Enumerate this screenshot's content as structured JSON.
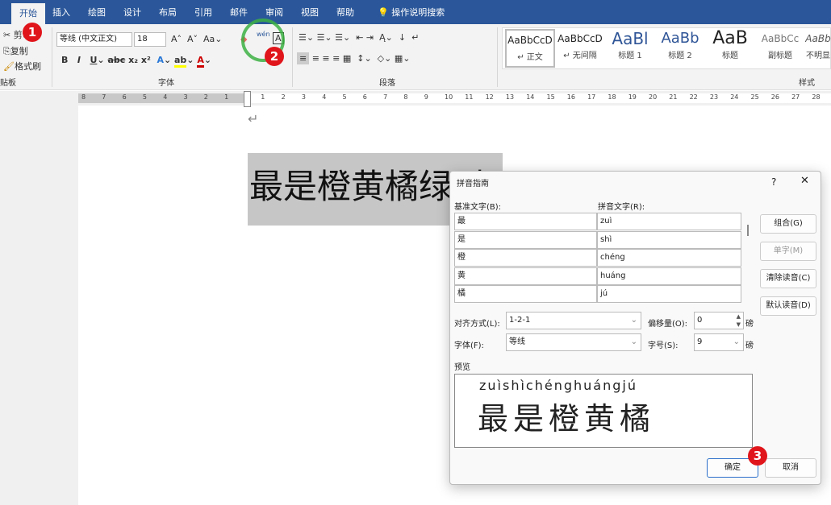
{
  "tabs": [
    "开始",
    "插入",
    "绘图",
    "设计",
    "布局",
    "引用",
    "邮件",
    "审阅",
    "视图",
    "帮助"
  ],
  "search": "操作说明搜索",
  "clipboard": {
    "cut": "剪切",
    "copy": "复制",
    "painter": "格式刷",
    "group": "贴板"
  },
  "font": {
    "name": "等线 (中文正文)",
    "size": "18",
    "group": "字体",
    "phonetic_icon": "wén"
  },
  "paragraph": {
    "group": "段落"
  },
  "styles": {
    "group": "样式",
    "items": [
      {
        "sample": "AaBbCcD",
        "name": "↵ 正文"
      },
      {
        "sample": "AaBbCcD",
        "name": "↵ 无间隔"
      },
      {
        "sample": "AaBl",
        "name": "标题 1"
      },
      {
        "sample": "AaBb",
        "name": "标题 2"
      },
      {
        "sample": "AaB",
        "name": "标题"
      },
      {
        "sample": "AaBbCc",
        "name": "副标题"
      },
      {
        "sample": "AaBb",
        "name": "不明显"
      }
    ]
  },
  "ruler": [
    "8",
    "7",
    "6",
    "5",
    "4",
    "3",
    "2",
    "1",
    "1",
    "2",
    "3",
    "4",
    "5",
    "6",
    "7",
    "8",
    "9",
    "10",
    "11",
    "12",
    "13",
    "14",
    "15",
    "16",
    "17",
    "18",
    "19",
    "20",
    "21",
    "22",
    "23",
    "24",
    "25",
    "26",
    "27",
    "28"
  ],
  "document": {
    "text": "最是橙黄橘绿时",
    "return_mark": "↵"
  },
  "dialog": {
    "title": "拼音指南",
    "help": "?",
    "close": "✕",
    "base_label": "基准文字(B):",
    "ruby_label": "拼音文字(R):",
    "rows": [
      {
        "base": "最",
        "ruby": "zuì"
      },
      {
        "base": "是",
        "ruby": "shì"
      },
      {
        "base": "橙",
        "ruby": "chéng"
      },
      {
        "base": "黄",
        "ruby": "huáng"
      },
      {
        "base": "橘",
        "ruby": "jú"
      }
    ],
    "buttons": {
      "group": "组合(G)",
      "mono": "单字(M)",
      "clear": "清除读音(C)",
      "default": "默认读音(D)",
      "ok": "确定",
      "cancel": "取消"
    },
    "align_label": "对齐方式(L):",
    "align_value": "1-2-1",
    "offset_label": "偏移量(O):",
    "offset_value": "0",
    "offset_unit": "磅",
    "font_label": "字体(F):",
    "font_value": "等线",
    "size_label": "字号(S):",
    "size_value": "9",
    "size_unit": "磅",
    "preview_label": "预览",
    "preview_ruby": "zuìshìchénghuángjú",
    "preview_base": "最是橙黄橘"
  },
  "badges": [
    "1",
    "2",
    "3"
  ],
  "colors": {
    "tabbar": "#2b579a",
    "badge": "#e0151b",
    "highlight_circle": "#3cb043"
  }
}
